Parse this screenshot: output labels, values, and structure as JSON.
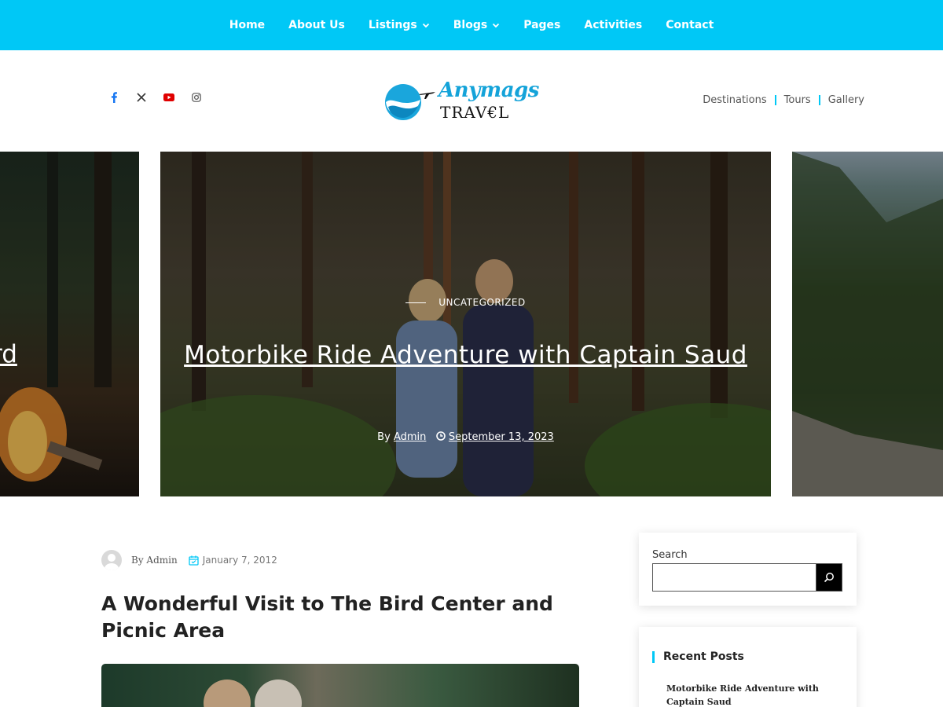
{
  "nav": {
    "items": [
      {
        "label": "Home",
        "dropdown": false
      },
      {
        "label": "About Us",
        "dropdown": false
      },
      {
        "label": "Listings",
        "dropdown": true
      },
      {
        "label": "Blogs",
        "dropdown": true
      },
      {
        "label": "Pages",
        "dropdown": false
      },
      {
        "label": "Activities",
        "dropdown": false
      },
      {
        "label": "Contact",
        "dropdown": false
      }
    ],
    "bg_color": "#00c8f6"
  },
  "header": {
    "socials": [
      "facebook-icon",
      "x-icon",
      "youtube-icon",
      "instagram-icon"
    ],
    "logo_title": "Anymags",
    "logo_sub": "TRAV€L",
    "quick_links": [
      "Destinations",
      "Tours",
      "Gallery"
    ]
  },
  "slider": {
    "left_partial_title": "rd",
    "category": "UNCATEGORIZED",
    "title": "Motorbike Ride Adventure with Captain Saud",
    "by": "By",
    "author": "Admin",
    "date": "September 13, 2023"
  },
  "post": {
    "by": "By Admin",
    "date": "January 7, 2012",
    "title": "A Wonderful Visit to The Bird Center and Picnic Area"
  },
  "sidebar": {
    "search_label": "Search",
    "search_value": "",
    "recent_heading": "Recent Posts",
    "recent_posts": [
      "Motorbike Ride Adventure with Captain Saud"
    ]
  },
  "colors": {
    "accent": "#00c8f6",
    "logo_blue": "#14a3d9",
    "youtube": "#e00000",
    "facebook": "#1877f2"
  }
}
